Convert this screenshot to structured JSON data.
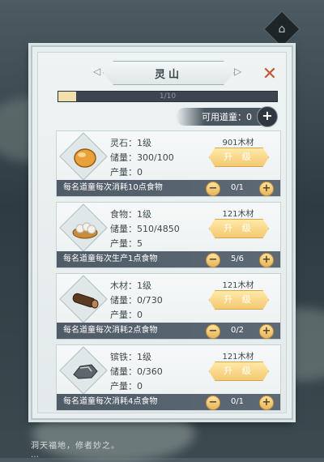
{
  "panel": {
    "title": "灵山",
    "progress_text": "1/10",
    "progress": 0.08
  },
  "available": {
    "label": "可用道童：",
    "value": "0"
  },
  "cards": [
    {
      "name": "灵石：",
      "level": "1级",
      "storage_label": "储量：",
      "storage": "300/100",
      "output_label": "产量：",
      "output": "0",
      "cost": "901木材",
      "upgrade": "升 级",
      "info": "每名道童每次消耗10点食物",
      "count": "0/1",
      "icon": "spirit-stone-icon"
    },
    {
      "name": "食物：",
      "level": "1级",
      "storage_label": "储量：",
      "storage": "510/4850",
      "output_label": "产量：",
      "output": "5",
      "cost": "121木材",
      "upgrade": "升 级",
      "info": "每名道童每次生产1点食物",
      "count": "5/6",
      "icon": "food-steamer-icon"
    },
    {
      "name": "木材：",
      "level": "1级",
      "storage_label": "储量：",
      "storage": "0/730",
      "output_label": "产量：",
      "output": "0",
      "cost": "121木材",
      "upgrade": "升 级",
      "info": "每名道童每次消耗2点食物",
      "count": "0/2",
      "icon": "wood-log-icon"
    },
    {
      "name": "镔铁：",
      "level": "1级",
      "storage_label": "储量：",
      "storage": "0/360",
      "output_label": "产量：",
      "output": "0",
      "cost": "121木材",
      "upgrade": "升 级",
      "info": "每名道童每次消耗4点食物",
      "count": "0/1",
      "icon": "iron-ore-icon"
    }
  ],
  "footer": {
    "line1": "洞天福地，修者妙之。",
    "line2": "…"
  }
}
